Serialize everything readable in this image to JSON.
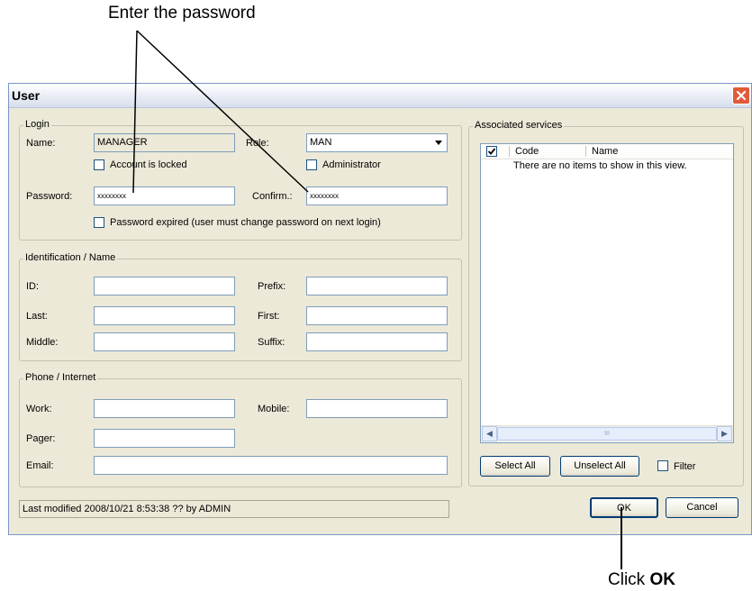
{
  "annotations": {
    "top_text": "Enter the password",
    "bottom_text_prefix": "Click ",
    "bottom_text_bold": "OK"
  },
  "window": {
    "title": "User",
    "close_icon": "close-icon"
  },
  "login": {
    "legend": "Login",
    "name_label": "Name:",
    "name_value": "MANAGER",
    "role_label": "Role:",
    "role_value": "MAN",
    "account_locked_label": "Account is locked",
    "administrator_label": "Administrator",
    "password_label": "Password:",
    "password_value": "xxxxxxxx",
    "confirm_label": "Confirm.:",
    "confirm_value": "xxxxxxxx",
    "password_expired_label": "Password expired (user must change password on next login)"
  },
  "identification": {
    "legend": "Identification / Name",
    "id_label": "ID:",
    "prefix_label": "Prefix:",
    "last_label": "Last:",
    "first_label": "First:",
    "middle_label": "Middle:",
    "suffix_label": "Suffix:"
  },
  "phone": {
    "legend": "Phone / Internet",
    "work_label": "Work:",
    "mobile_label": "Mobile:",
    "pager_label": "Pager:",
    "email_label": "Email:"
  },
  "services": {
    "legend": "Associated services",
    "col_code": "Code",
    "col_name": "Name",
    "empty_text": "There are no items to show in this view.",
    "select_all": "Select All",
    "unselect_all": "Unselect All",
    "filter_label": "Filter",
    "scroll_grip": "III"
  },
  "footer": {
    "status": "Last modified 2008/10/21 8:53:38 ?? by ADMIN",
    "ok": "OK",
    "cancel": "Cancel"
  }
}
